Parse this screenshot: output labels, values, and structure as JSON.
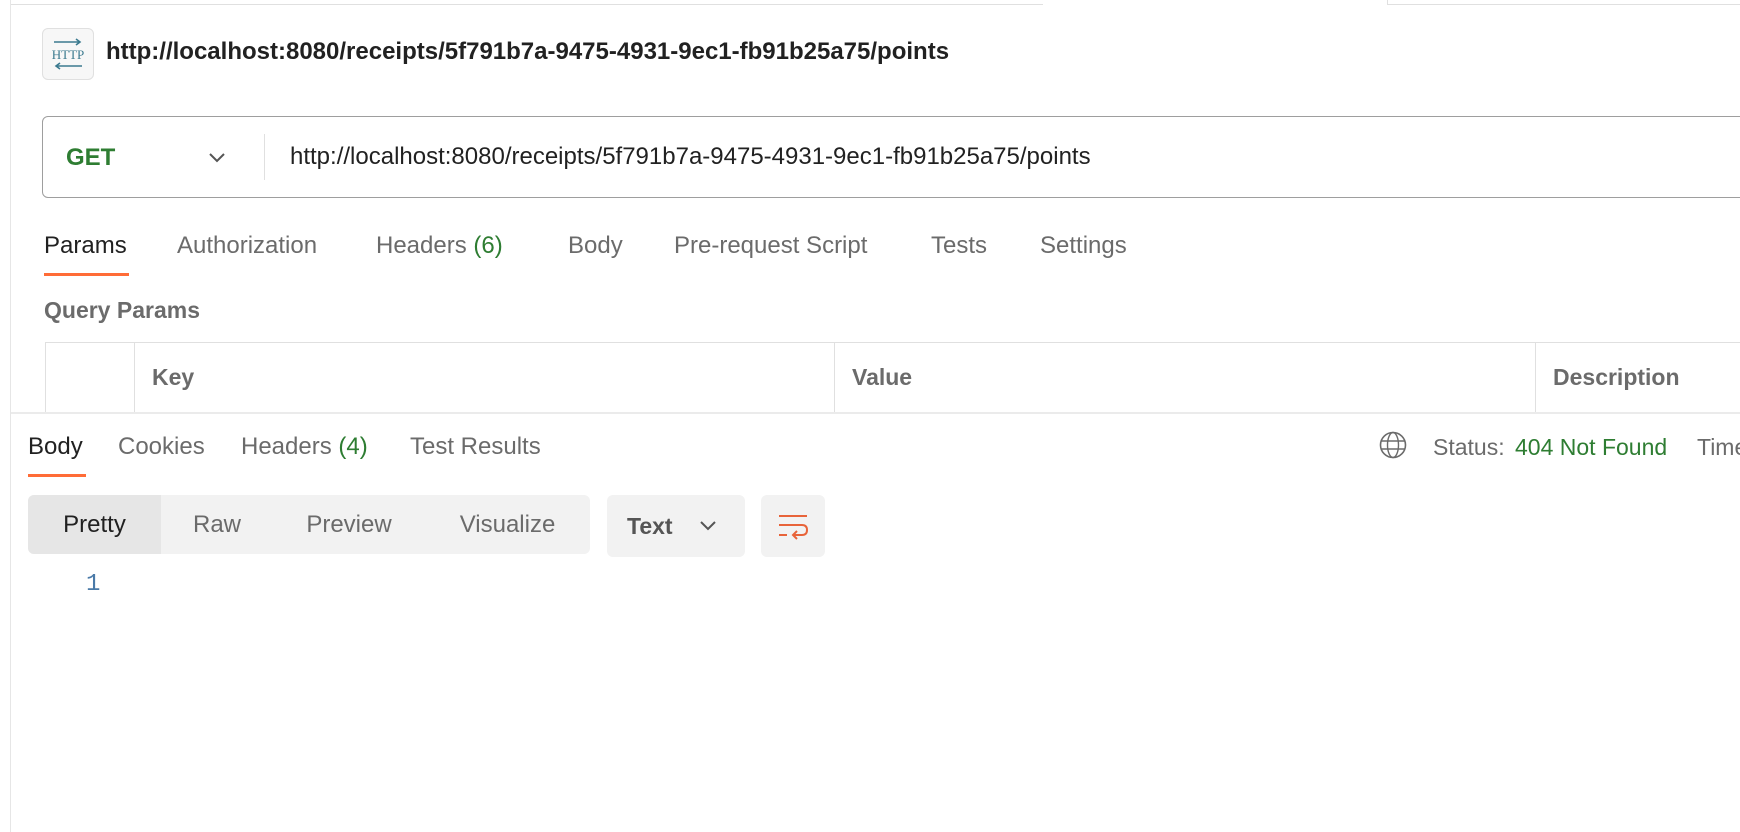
{
  "request": {
    "icon": "http-icon",
    "title": "http://localhost:8080/receipts/5f791b7a-9475-4931-9ec1-fb91b25a75/points",
    "method": "GET",
    "url": "http://localhost:8080/receipts/5f791b7a-9475-4931-9ec1-fb91b25a75/points"
  },
  "request_tabs": {
    "params": "Params",
    "authorization": "Authorization",
    "headers": "Headers",
    "headers_count": "(6)",
    "body": "Body",
    "prerequest": "Pre-request Script",
    "tests": "Tests",
    "settings": "Settings",
    "active": "Params"
  },
  "query_params": {
    "label": "Query Params",
    "columns": [
      "Key",
      "Value",
      "Description"
    ]
  },
  "response_tabs": {
    "body": "Body",
    "cookies": "Cookies",
    "headers": "Headers",
    "headers_count": "(4)",
    "test_results": "Test Results",
    "active": "Body"
  },
  "status": {
    "label": "Status:",
    "value": "404 Not Found",
    "time_label": "Time"
  },
  "view_modes": {
    "pretty": "Pretty",
    "raw": "Raw",
    "preview": "Preview",
    "visualize": "Visualize",
    "active": "Pretty"
  },
  "format": {
    "selected": "Text"
  },
  "editor": {
    "line_numbers": [
      "1"
    ]
  },
  "colors": {
    "accent": "#ff6c37",
    "method_get": "#2e7d32",
    "status_ok": "#2e7d32",
    "line_number": "#4a7aa8"
  }
}
